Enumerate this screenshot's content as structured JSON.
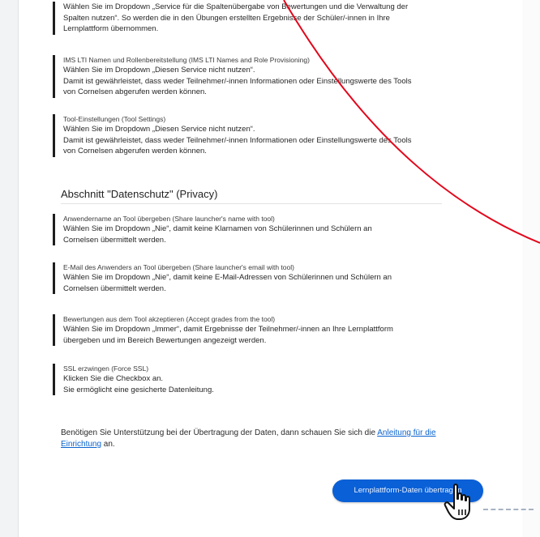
{
  "blocks": [
    {
      "caption": "",
      "lines": [
        "Wählen Sie im Dropdown „Service für die Spaltenübergabe von Bewertungen und die Verwaltung der",
        "Spalten nutzen“. So werden die in den Übungen erstellten Ergebnisse der Schüler/-innen in Ihre",
        "Lernplattform übernommen."
      ]
    },
    {
      "caption": "IMS LTI Namen und Rollenbereitstellung (IMS LTI Names and Role Provisioning)",
      "lines": [
        "Wählen Sie im Dropdown „Diesen Service nicht nutzen“.",
        "Damit ist gewährleistet, dass weder Teilnehmer/-innen Informationen oder Einstellungswerte des Tools",
        "von Cornelsen abgerufen werden können."
      ]
    },
    {
      "caption": "Tool-Einstellungen (Tool Settings)",
      "lines": [
        "Wählen Sie im Dropdown „Diesen Service nicht nutzen“.",
        "Damit ist gewährleistet, dass weder Teilnehmer/-innen Informationen oder Einstellungswerte des Tools",
        "von Cornelsen abgerufen werden können."
      ]
    },
    {
      "caption": "Anwendername an Tool übergeben (Share launcher's name with tool)",
      "lines": [
        "Wählen Sie im Dropdown „Nie“, damit keine Klarnamen von Schülerinnen und Schülern an",
        "Cornelsen übermittelt werden."
      ]
    },
    {
      "caption": "E-Mail des Anwenders an Tool übergeben (Share launcher's email with tool)",
      "lines": [
        "Wählen Sie im Dropdown „Nie“, damit keine E-Mail-Adressen von Schülerinnen und Schülern an",
        "Cornelsen übermittelt werden."
      ]
    },
    {
      "caption": "Bewertungen aus dem Tool akzeptieren (Accept grades from the tool)",
      "lines": [
        "Wählen Sie im Dropdown „Immer“, damit Ergebnisse der Teilnehmer/-innen an Ihre Lernplattform",
        "übergeben und im Bereich Bewertungen angezeigt werden."
      ]
    },
    {
      "caption": "SSL erzwingen (Force SSL)",
      "lines": [
        "Klicken Sie die Checkbox an.",
        "Sie ermöglicht eine gesicherte Datenleitung."
      ]
    }
  ],
  "section_heading": "Abschnitt \"Datenschutz\" (Privacy)",
  "help": {
    "text": "Benötigen Sie Unterstützung bei der Übertragung der Daten, dann schauen Sie sich die ",
    "link": "Anleitung für die Einrichtung",
    "suffix": " an."
  },
  "primary_button": {
    "label": "Lernplattform-Daten übertragen"
  },
  "colors": {
    "accent": "#0a60d6",
    "annotation": "#e3061b",
    "link": "#0b63ce"
  },
  "icons": {
    "cursor": "hand-pointer-icon"
  }
}
